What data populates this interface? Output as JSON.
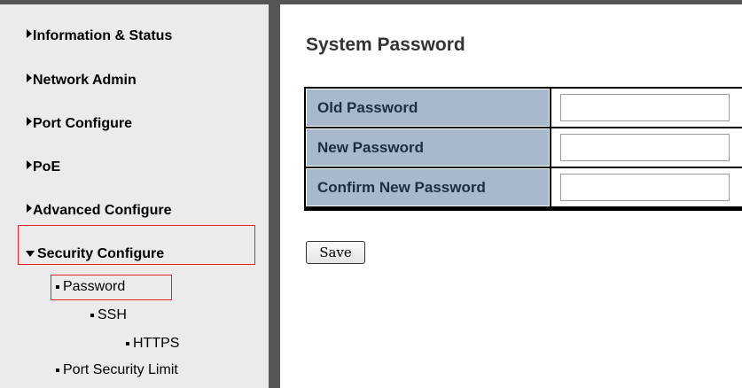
{
  "sidebar": {
    "items": [
      {
        "label": "Information & Status"
      },
      {
        "label": "Network Admin"
      },
      {
        "label": "Port Configure"
      },
      {
        "label": "PoE"
      },
      {
        "label": "Advanced Configure"
      },
      {
        "label": "Security Configure"
      }
    ],
    "sub_items": [
      {
        "label": "Password"
      },
      {
        "label": "SSH"
      },
      {
        "label": "HTTPS"
      },
      {
        "label": "Port Security Limit"
      }
    ]
  },
  "main": {
    "title": "System Password",
    "fields": [
      {
        "label": "Old Password",
        "value": ""
      },
      {
        "label": "New Password",
        "value": ""
      },
      {
        "label": "Confirm New Password",
        "value": ""
      }
    ],
    "save_label": "Save"
  },
  "colors": {
    "sidebar_bg": "#ebebeb",
    "divider": "#565656",
    "label_cell_bg": "#a8b9cc",
    "highlight": "#e2242b"
  }
}
